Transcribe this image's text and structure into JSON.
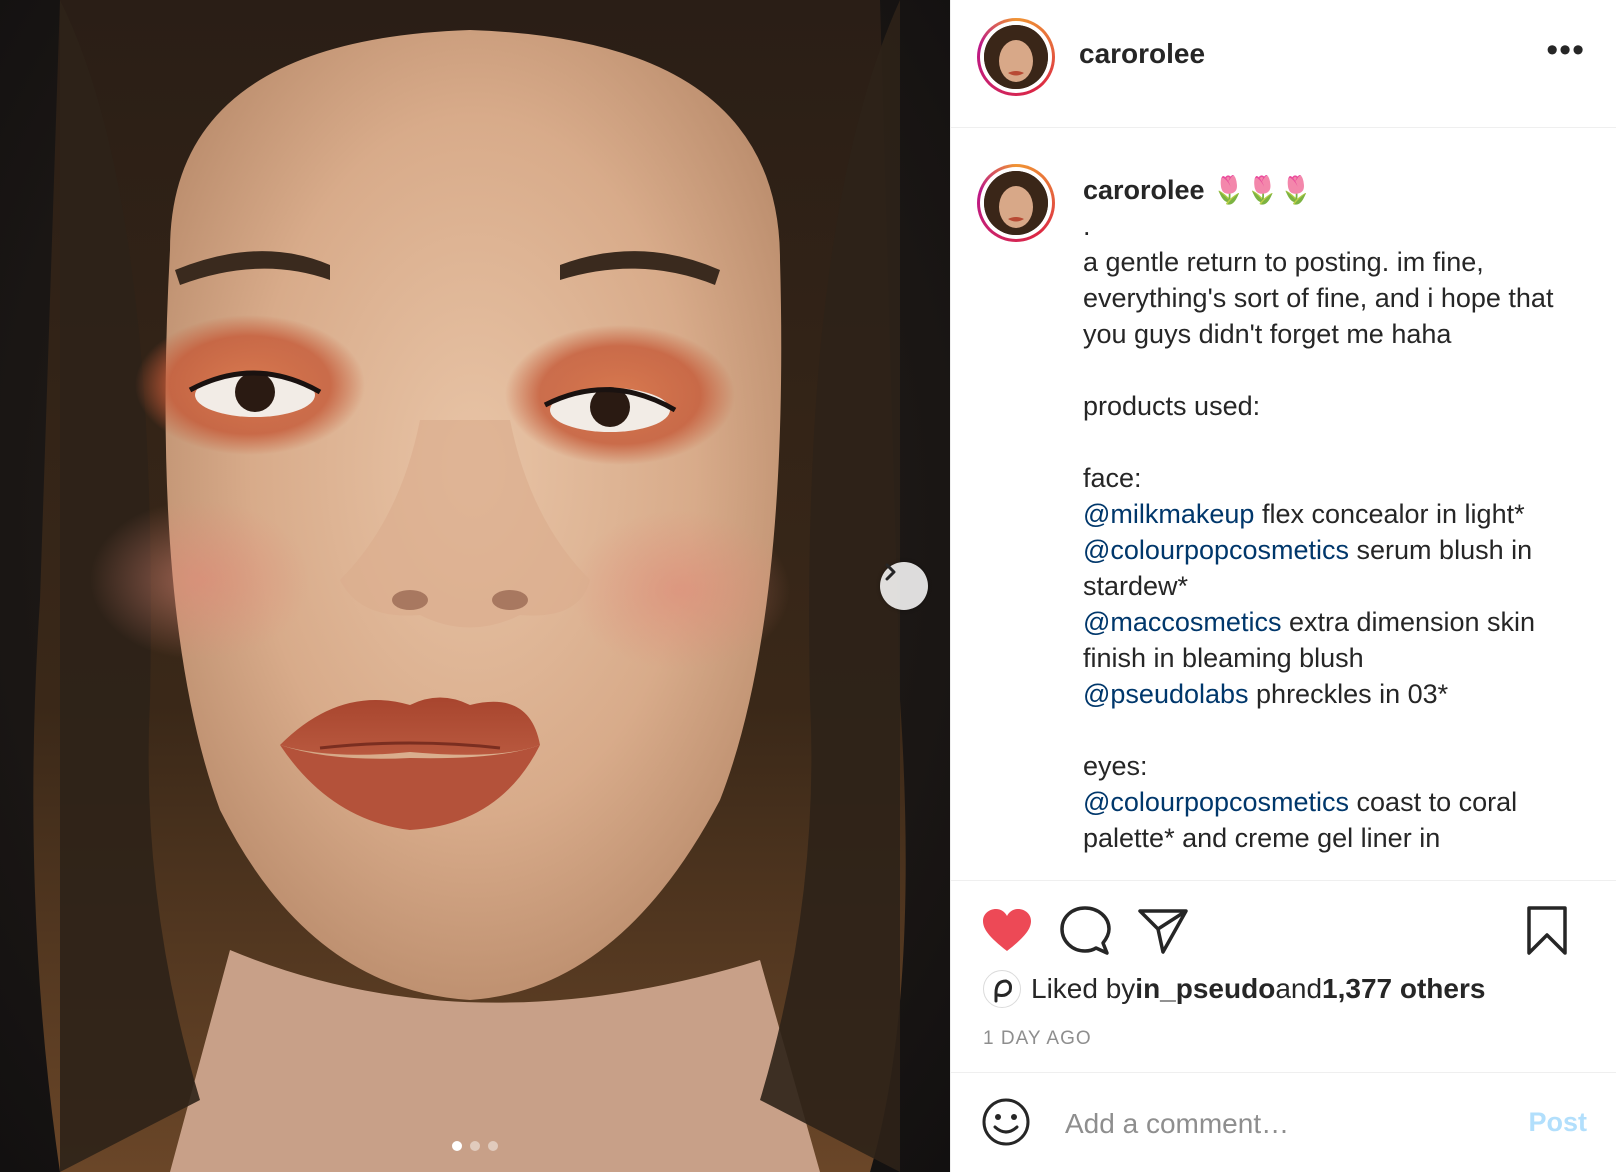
{
  "post": {
    "username": "carorolee",
    "more_label": "•••",
    "next_icon": "chevron-right-icon",
    "carousel": {
      "total": 3,
      "active": 1
    }
  },
  "caption": {
    "username": "carorolee",
    "emoji": "🌷🌷🌷",
    "lines": [
      {
        "text": "."
      },
      {
        "text": "a gentle return to posting. im fine, everything's sort of fine, and i hope that you guys didn't forget me haha"
      },
      {
        "text": ""
      },
      {
        "text": "products used:"
      },
      {
        "text": ""
      },
      {
        "text": "face:"
      },
      {
        "mention": "@milkmakeup",
        "text": " flex concealor in light*"
      },
      {
        "mention": "@colourpopcosmetics",
        "text": " serum blush in stardew*"
      },
      {
        "mention": "@maccosmetics",
        "text": " extra dimension skin finish in bleaming blush"
      },
      {
        "mention": "@pseudolabs",
        "text": " phreckles in 03*"
      },
      {
        "text": ""
      },
      {
        "text": "eyes:"
      },
      {
        "mention": "@colourpopcosmetics",
        "text": " coast to coral palette* and creme gel liner in"
      }
    ]
  },
  "actions": {
    "like_icon": "heart-filled-icon",
    "comment_icon": "comment-icon",
    "share_icon": "paper-plane-icon",
    "save_icon": "bookmark-icon",
    "like_color": "#ed4956"
  },
  "likes": {
    "prefix": "Liked by ",
    "user": "in_pseudo",
    "middle": " and ",
    "count": "1,377 others"
  },
  "time_ago": "1 DAY AGO",
  "comment": {
    "placeholder": "Add a comment…",
    "post_label": "Post",
    "emoji_icon": "smiley-icon"
  }
}
